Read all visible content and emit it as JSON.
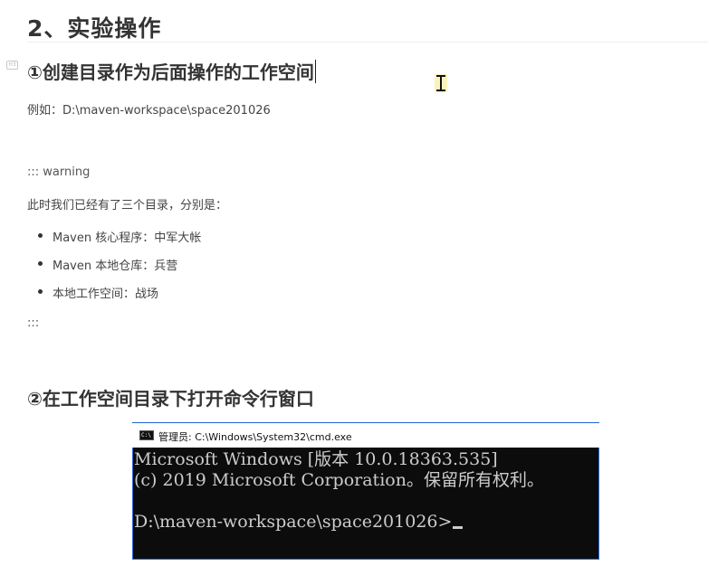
{
  "section": {
    "title": "2、实验操作"
  },
  "step1": {
    "heading": "①创建目录作为后面操作的工作空间",
    "example": "例如：D:\\maven-workspace\\space201026"
  },
  "warning": {
    "open": "::: warning",
    "intro": "此时我们已经有了三个目录，分别是：",
    "items": [
      "Maven 核心程序：中军大帐",
      "Maven 本地仓库：兵营",
      "本地工作空间：战场"
    ],
    "close": ":::"
  },
  "step2": {
    "heading": "②在工作空间目录下打开命令行窗口"
  },
  "cmd": {
    "title": "管理员: C:\\Windows\\System32\\cmd.exe",
    "lines": [
      "Microsoft Windows [版本 10.0.18363.535]",
      "(c) 2019 Microsoft Corporation。保留所有权利。",
      "D:\\maven-workspace\\space201026>"
    ],
    "icon": "cmd-icon"
  }
}
